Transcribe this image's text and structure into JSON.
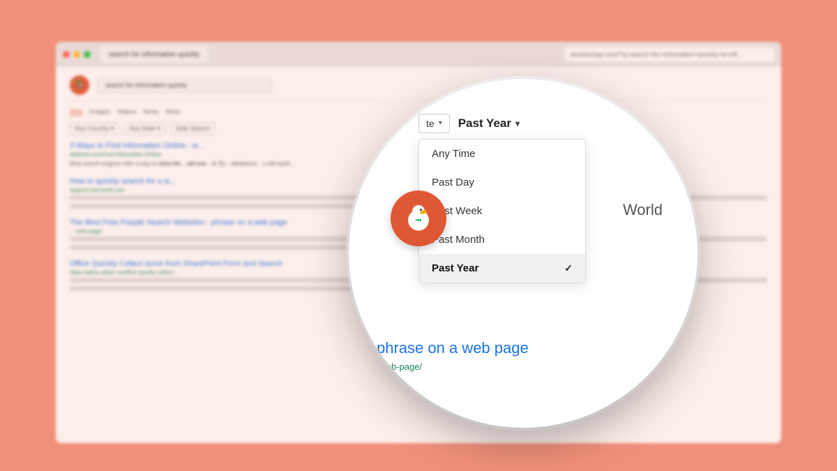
{
  "background_color": "#f0907a",
  "browser": {
    "tab_label": "search for information quickly",
    "address": "duckduckgo.com/?q=search+for+information+quickly+to+eff...",
    "search_query": "search for information quickly"
  },
  "filter_tabs": [
    "Web",
    "Images",
    "Videos",
    "News",
    "More"
  ],
  "filter_buttons": [
    "Any Country",
    "Any Date",
    "Safe Search"
  ],
  "results": [
    {
      "title": "3 Ways to Find Information Online - w...",
      "url": "wikihow.com/Find-Information-Online",
      "snippet": "Most search engines offer a way to ction-On... uld eve... it. By... databases... u will quick..."
    },
    {
      "title": "How to quickly search for a w...",
      "url": "support.microsoft.com",
      "snippet": "phrase on a web page"
    },
    {
      "title": "Office Quickly Collect some from SharePoint Form and Search",
      "url": "https://qfmo.ubbto.us/office-quickly-collect...",
      "snippet": ""
    }
  ],
  "dropdown": {
    "trigger_label": "Past Year",
    "chevron": "▾",
    "items": [
      {
        "label": "Any Time",
        "selected": false
      },
      {
        "label": "Past Day",
        "selected": false
      },
      {
        "label": "Past Week",
        "selected": false
      },
      {
        "label": "Past Month",
        "selected": false
      },
      {
        "label": "Past Year",
        "selected": true
      }
    ]
  },
  "result_detail": {
    "title": "phrase on a web page",
    "url": "-web-page/",
    "world_label": "World"
  },
  "other_filter_label": "te",
  "checkmark_char": "✓"
}
